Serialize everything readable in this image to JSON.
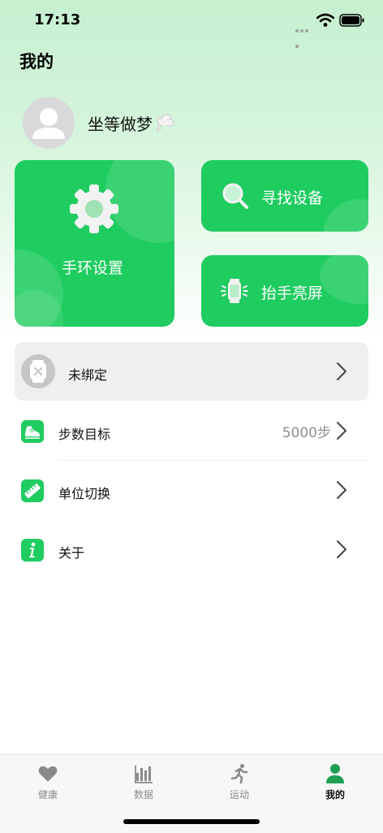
{
  "status_bar": {
    "time": "17:13"
  },
  "header": {
    "title": "我的"
  },
  "profile": {
    "nickname": "坐等做梦",
    "emoji_icon": "thought-bubble-icon"
  },
  "cards": {
    "band_settings": {
      "label": "手环设置",
      "icon": "gear-icon"
    },
    "find_device": {
      "label": "寻找设备",
      "icon": "magnifier-icon"
    },
    "raise_to_wake": {
      "label": "抬手亮屏",
      "icon": "watch-glow-icon"
    }
  },
  "device": {
    "status_label": "未绑定",
    "icon": "watch-unbound-icon"
  },
  "menu": {
    "items": [
      {
        "label": "步数目标",
        "value": "5000步",
        "icon": "sneaker-icon"
      },
      {
        "label": "单位切换",
        "icon": "ruler-icon"
      },
      {
        "label": "关于",
        "icon": "info-icon"
      }
    ]
  },
  "tab_bar": {
    "tabs": [
      {
        "label": "健康",
        "icon": "heart-icon",
        "active": false
      },
      {
        "label": "数据",
        "icon": "bar-chart-icon",
        "active": false
      },
      {
        "label": "运动",
        "icon": "runner-icon",
        "active": false
      },
      {
        "label": "我的",
        "icon": "person-icon",
        "active": true
      }
    ]
  },
  "colors": {
    "accent": "#1fcc60",
    "header_gradient_top": "#c6f0d0",
    "inactive_tab": "#8a8a8a"
  }
}
